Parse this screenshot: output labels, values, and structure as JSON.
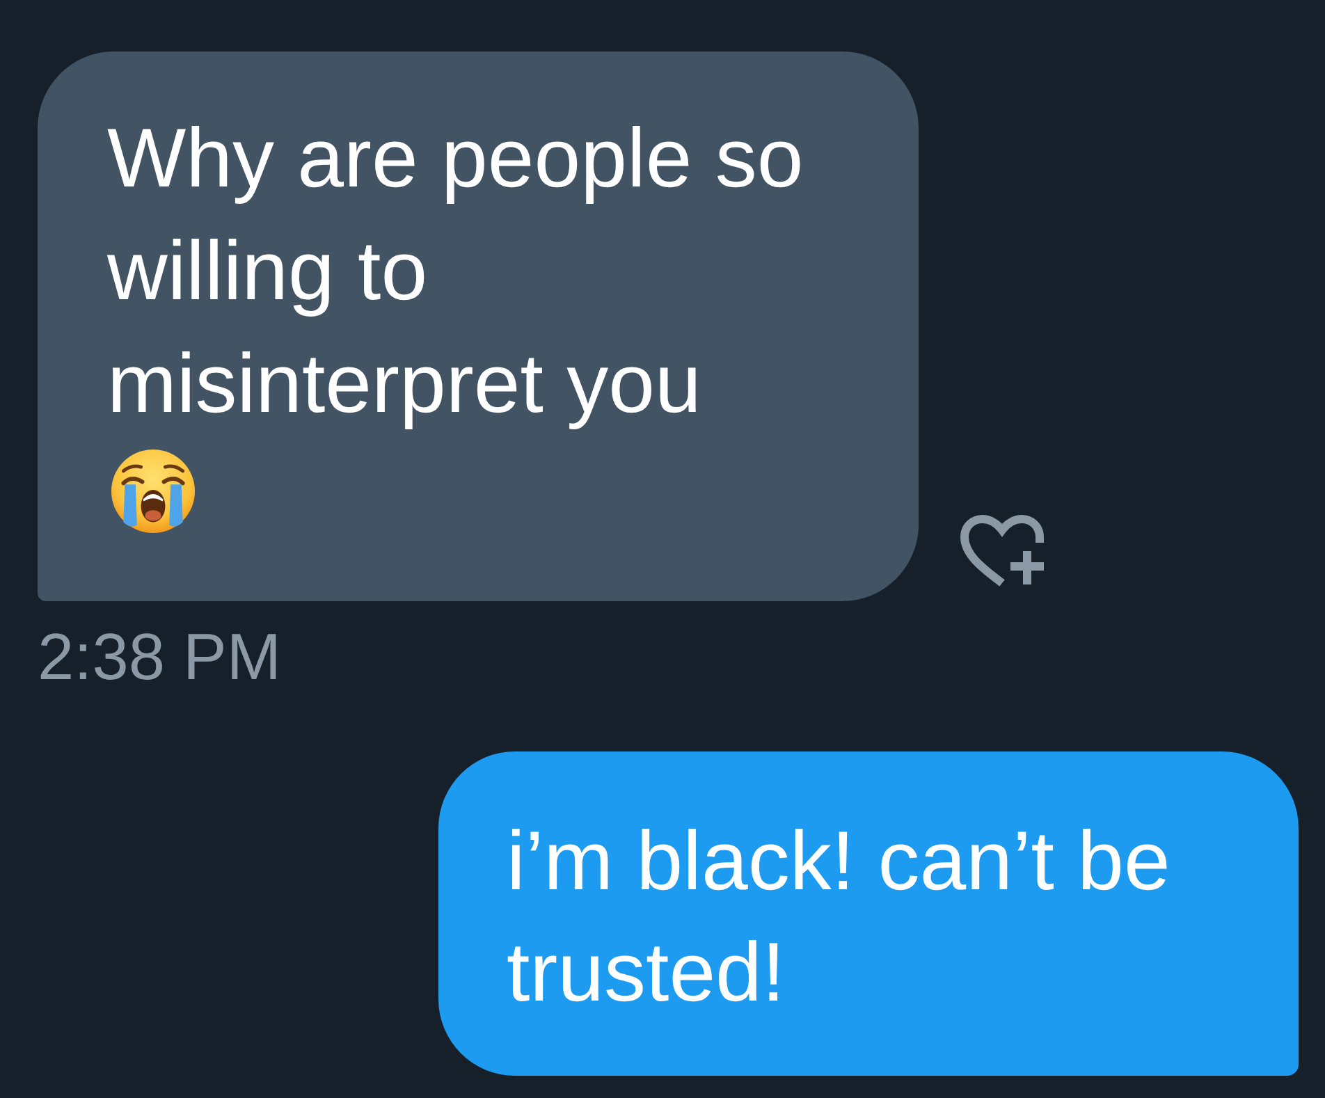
{
  "messages": [
    {
      "kind": "received",
      "text": "Why are people so willing to misinterpret you",
      "emoji": true,
      "react_button": true,
      "time": "2:38 PM"
    },
    {
      "kind": "sent",
      "text": "i’m black! can’t be trusted!"
    }
  ]
}
